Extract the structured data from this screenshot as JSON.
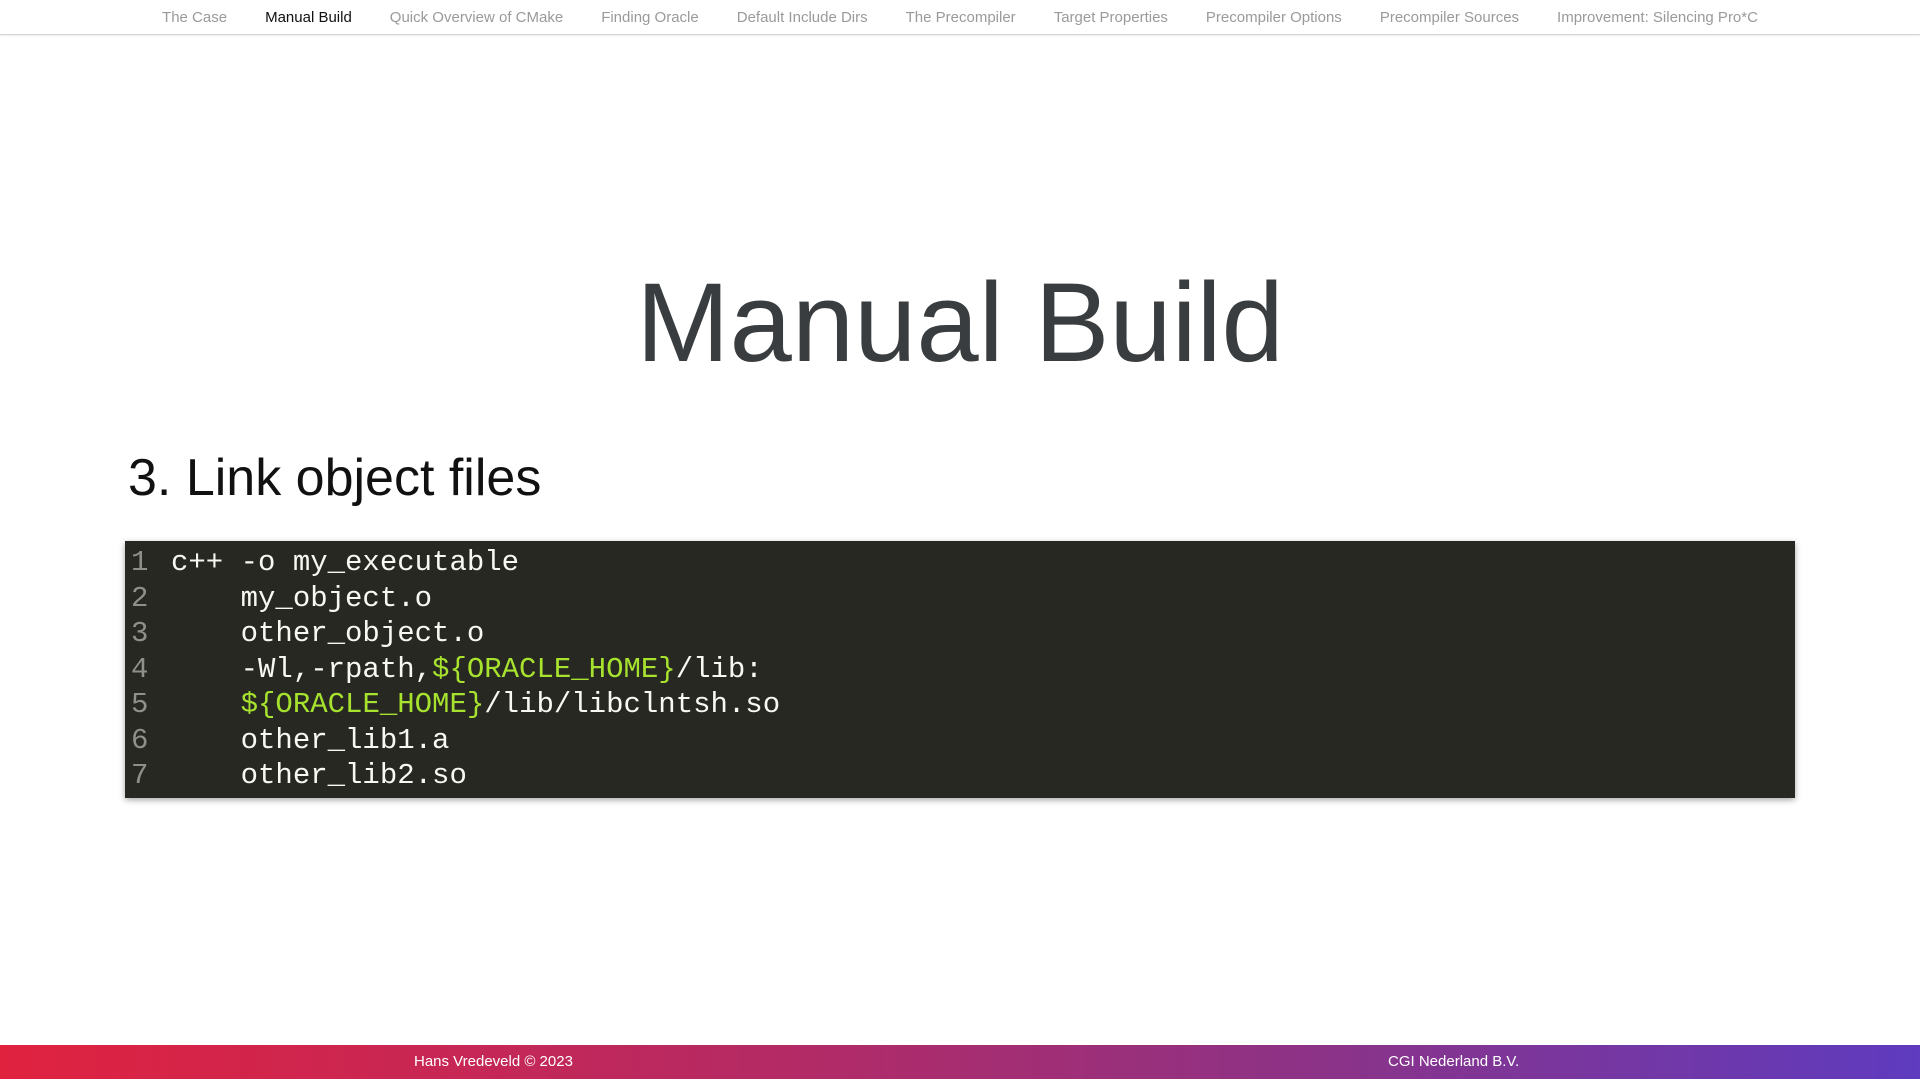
{
  "nav": {
    "items": [
      {
        "label": "The Case",
        "active": false
      },
      {
        "label": "Manual Build",
        "active": true
      },
      {
        "label": "Quick Overview of CMake",
        "active": false
      },
      {
        "label": "Finding Oracle",
        "active": false
      },
      {
        "label": "Default Include Dirs",
        "active": false
      },
      {
        "label": "The Precompiler",
        "active": false
      },
      {
        "label": "Target Properties",
        "active": false
      },
      {
        "label": "Precompiler Options",
        "active": false
      },
      {
        "label": "Precompiler Sources",
        "active": false
      },
      {
        "label": "Improvement: Silencing Pro*C",
        "active": false
      }
    ]
  },
  "slide": {
    "title": "Manual Build",
    "step_heading": "3. Link object files"
  },
  "code": {
    "lines": [
      {
        "number": "1",
        "segments": [
          {
            "text": "c++ -o my_executable",
            "type": "plain"
          }
        ]
      },
      {
        "number": "2",
        "segments": [
          {
            "text": "    my_object.o",
            "type": "plain"
          }
        ]
      },
      {
        "number": "3",
        "segments": [
          {
            "text": "    other_object.o",
            "type": "plain"
          }
        ]
      },
      {
        "number": "4",
        "segments": [
          {
            "text": "    -Wl,-rpath,",
            "type": "plain"
          },
          {
            "text": "${ORACLE_HOME}",
            "type": "var"
          },
          {
            "text": "/lib:",
            "type": "plain"
          }
        ]
      },
      {
        "number": "5",
        "segments": [
          {
            "text": "    ",
            "type": "plain"
          },
          {
            "text": "${ORACLE_HOME}",
            "type": "var"
          },
          {
            "text": "/lib/libclntsh.so",
            "type": "plain"
          }
        ]
      },
      {
        "number": "6",
        "segments": [
          {
            "text": "    other_lib1.a",
            "type": "plain"
          }
        ]
      },
      {
        "number": "7",
        "segments": [
          {
            "text": "    other_lib2.so",
            "type": "plain"
          }
        ]
      }
    ]
  },
  "footer": {
    "author": "Hans Vredeveld © 2023",
    "company": "CGI Nederland B.V."
  },
  "colors": {
    "code_background": "#272822",
    "code_variable": "#a6e22e",
    "nav_active": "#111111",
    "nav_inactive": "#9a9a9a",
    "footer_gradient_start": "#e0223f",
    "footer_gradient_end": "#5e3bbf"
  }
}
